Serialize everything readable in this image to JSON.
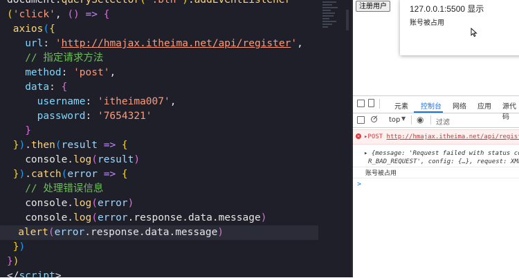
{
  "editor": {
    "lines": [
      [
        {
          "c": "plain",
          "t": "document."
        },
        {
          "c": "fn",
          "t": "querySelector"
        },
        {
          "c": "b1",
          "t": "("
        },
        {
          "c": "str",
          "t": "'.btn'"
        },
        {
          "c": "b1",
          "t": ")"
        },
        {
          "c": "plain",
          "t": "."
        },
        {
          "c": "fn",
          "t": "addEventListener"
        }
      ],
      [
        {
          "c": "b1",
          "t": "("
        },
        {
          "c": "str",
          "t": "'click'"
        },
        {
          "c": "plain",
          "t": ", "
        },
        {
          "c": "b2",
          "t": "()"
        },
        {
          "c": "arrow",
          "t": " => "
        },
        {
          "c": "b2",
          "t": "{"
        }
      ],
      [
        {
          "c": "plain",
          "t": " "
        },
        {
          "c": "fn",
          "t": "axios"
        },
        {
          "c": "b3",
          "t": "("
        },
        {
          "c": "b1",
          "t": "{"
        }
      ],
      [
        {
          "c": "plain",
          "t": "   "
        },
        {
          "c": "prop",
          "t": "url"
        },
        {
          "c": "plain",
          "t": ": "
        },
        {
          "c": "str",
          "t": "'"
        },
        {
          "c": "url",
          "t": "http://hmajax.itheima.net/api/register"
        },
        {
          "c": "str",
          "t": "'"
        },
        {
          "c": "plain",
          "t": ","
        }
      ],
      [
        {
          "c": "plain",
          "t": "   "
        },
        {
          "c": "cmt",
          "t": "// 指定请求方法"
        }
      ],
      [
        {
          "c": "plain",
          "t": "   "
        },
        {
          "c": "prop",
          "t": "method"
        },
        {
          "c": "plain",
          "t": ": "
        },
        {
          "c": "str",
          "t": "'post'"
        },
        {
          "c": "plain",
          "t": ","
        }
      ],
      [
        {
          "c": "plain",
          "t": "   "
        },
        {
          "c": "prop",
          "t": "data"
        },
        {
          "c": "plain",
          "t": ": "
        },
        {
          "c": "b2",
          "t": "{"
        }
      ],
      [
        {
          "c": "plain",
          "t": "     "
        },
        {
          "c": "prop",
          "t": "username"
        },
        {
          "c": "plain",
          "t": ": "
        },
        {
          "c": "str",
          "t": "'itheima007'"
        },
        {
          "c": "plain",
          "t": ","
        }
      ],
      [
        {
          "c": "plain",
          "t": "     "
        },
        {
          "c": "prop",
          "t": "password"
        },
        {
          "c": "plain",
          "t": ": "
        },
        {
          "c": "str",
          "t": "'7654321'"
        }
      ],
      [
        {
          "c": "plain",
          "t": "   "
        },
        {
          "c": "b2",
          "t": "}"
        }
      ],
      [
        {
          "c": "plain",
          "t": " "
        },
        {
          "c": "b1",
          "t": "}"
        },
        {
          "c": "b3",
          "t": ")"
        },
        {
          "c": "plain",
          "t": "."
        },
        {
          "c": "fn",
          "t": "then"
        },
        {
          "c": "b3",
          "t": "("
        },
        {
          "c": "param",
          "t": "result"
        },
        {
          "c": "arrow",
          "t": " => "
        },
        {
          "c": "b1",
          "t": "{"
        }
      ],
      [
        {
          "c": "plain",
          "t": "   "
        },
        {
          "c": "plain",
          "t": "console."
        },
        {
          "c": "fn",
          "t": "log"
        },
        {
          "c": "b2",
          "t": "("
        },
        {
          "c": "param",
          "t": "result"
        },
        {
          "c": "b2",
          "t": ")"
        }
      ],
      [
        {
          "c": "plain",
          "t": " "
        },
        {
          "c": "b1",
          "t": "}"
        },
        {
          "c": "b3",
          "t": ")"
        },
        {
          "c": "plain",
          "t": "."
        },
        {
          "c": "fn",
          "t": "catch"
        },
        {
          "c": "b3",
          "t": "("
        },
        {
          "c": "param",
          "t": "error"
        },
        {
          "c": "arrow",
          "t": " => "
        },
        {
          "c": "b1",
          "t": "{"
        }
      ],
      [
        {
          "c": "plain",
          "t": "   "
        },
        {
          "c": "cmt",
          "t": "// 处理错误信息"
        }
      ],
      [
        {
          "c": "plain",
          "t": "   "
        },
        {
          "c": "plain",
          "t": "console."
        },
        {
          "c": "fn",
          "t": "log"
        },
        {
          "c": "b2",
          "t": "("
        },
        {
          "c": "param",
          "t": "error"
        },
        {
          "c": "b2",
          "t": ")"
        }
      ],
      [
        {
          "c": "plain",
          "t": "   "
        },
        {
          "c": "plain",
          "t": "console."
        },
        {
          "c": "fn",
          "t": "log"
        },
        {
          "c": "b2",
          "t": "("
        },
        {
          "c": "param",
          "t": "error"
        },
        {
          "c": "plain",
          "t": ".response.data.message"
        },
        {
          "c": "b2",
          "t": ")"
        }
      ],
      [
        {
          "c": "plain",
          "t": "   "
        },
        {
          "c": "fn",
          "t": "alert"
        },
        {
          "c": "b2",
          "t": "("
        },
        {
          "c": "param",
          "t": "error"
        },
        {
          "c": "plain",
          "t": ".response.data.message"
        },
        {
          "c": "b2",
          "t": ")"
        }
      ],
      [
        {
          "c": "plain",
          "t": " "
        },
        {
          "c": "b1",
          "t": "}"
        },
        {
          "c": "b3",
          "t": ")"
        }
      ],
      [
        {
          "c": "b2",
          "t": "}"
        },
        {
          "c": "b1",
          "t": ")"
        }
      ],
      [
        {
          "c": "plain",
          "t": "</"
        },
        {
          "c": "prop",
          "t": "script"
        },
        {
          "c": "plain",
          "t": ">"
        }
      ]
    ],
    "highlighted_line": 16
  },
  "page": {
    "register_button": "注册用户"
  },
  "alert": {
    "title": "127.0.0.1:5500 显示",
    "message": "账号被占用"
  },
  "devtools": {
    "tabs": [
      "元素",
      "控制台",
      "网络",
      "应用",
      "源代码"
    ],
    "active_tab": "控制台",
    "context": "top",
    "filter_placeholder": "过滤",
    "error_method": "POST",
    "error_url": "http://hmajax.itheima.net/api/register",
    "object_line1": "{message: 'Request failed with status co",
    "object_line2": "R_BAD_REQUEST', config: {…}, request: XMLH",
    "log_message": "账号被占用",
    "prompt": ">"
  },
  "colors": {
    "editor_bg": "#1e1f28",
    "string": "#ff9a7a",
    "property": "#7fd8ff",
    "function": "#ffd479",
    "comment": "#6fbf59",
    "error_red": "#e0383d",
    "devtools_accent": "#1a73e8"
  },
  "icons": [
    "inspect-icon",
    "device-icon",
    "sidebar-icon",
    "clear-icon",
    "eye-icon",
    "error-icon",
    "pointer-cursor-icon"
  ]
}
